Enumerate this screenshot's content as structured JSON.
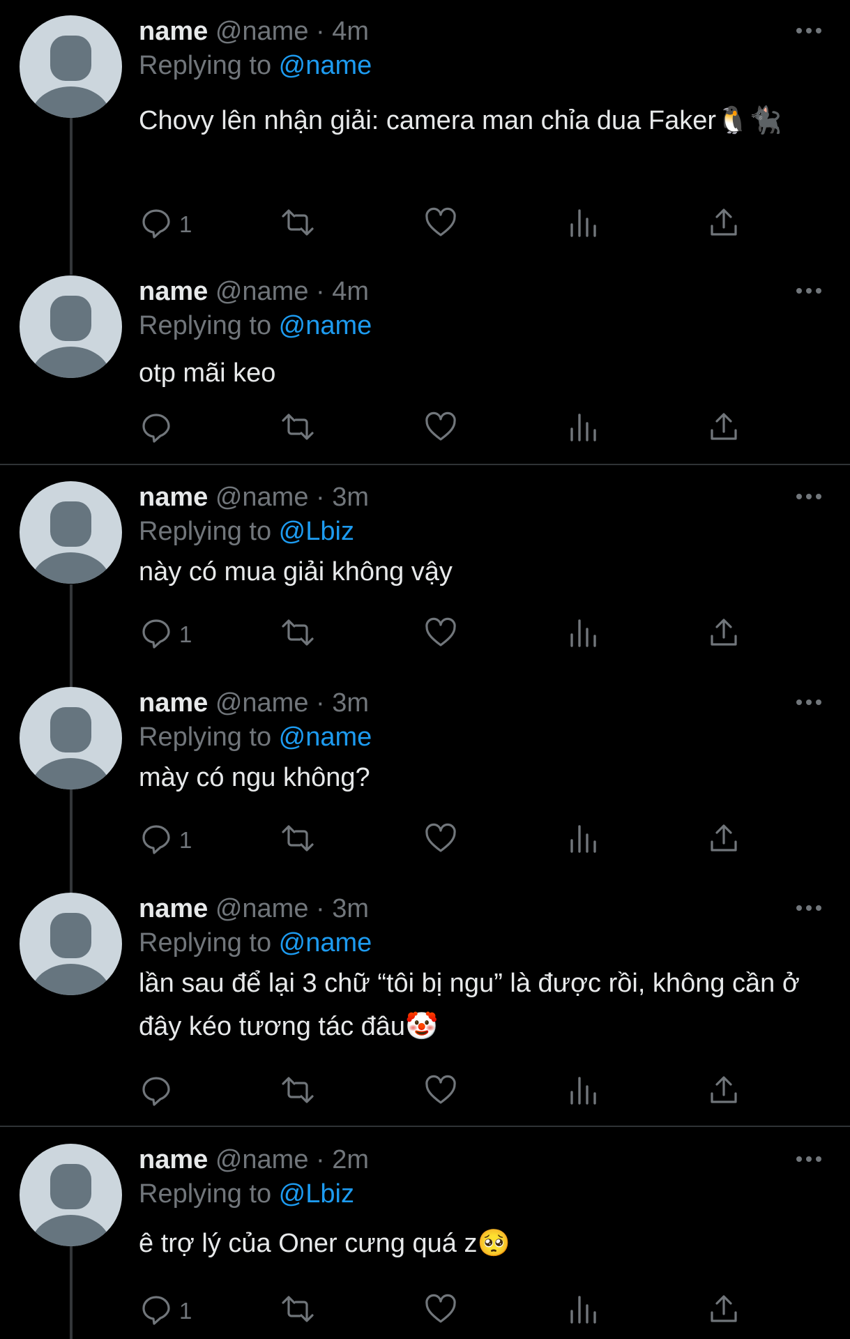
{
  "tweets": [
    {
      "name": "name",
      "meta": "@name · 4m",
      "replying_prefix": "Replying to ",
      "replying_handle": "@name",
      "text": "Chovy lên nhận giải: camera man chỉa dua Faker",
      "emoji": "🐧🐈‍⬛",
      "reply_count": "1"
    },
    {
      "name": "name",
      "meta": "@name · 4m",
      "replying_prefix": "Replying to ",
      "replying_handle": "@name",
      "text": "otp mãi keo",
      "reply_count": ""
    },
    {
      "name": "name",
      "meta": "@name · 3m",
      "replying_prefix": "Replying to ",
      "replying_handle": "@Lbiz",
      "text": "này có mua giải không vậy",
      "reply_count": "1"
    },
    {
      "name": "name",
      "meta": "@name · 3m",
      "replying_prefix": "Replying to ",
      "replying_handle": "@name",
      "text": "mày có ngu không?",
      "reply_count": "1"
    },
    {
      "name": "name",
      "meta": "@name · 3m",
      "replying_prefix": "Replying to ",
      "replying_handle": "@name",
      "text": "lần sau để lại 3 chữ “tôi bị ngu” là được rồi, không cần ở đây kéo tương tác đâu",
      "emoji": "🤡",
      "reply_count": ""
    },
    {
      "name": "name",
      "meta": "@name · 2m",
      "replying_prefix": "Replying to ",
      "replying_handle": "@Lbiz",
      "text": "ê trợ lý của Oner cưng quá z",
      "emoji": "🥺",
      "reply_count": "1"
    }
  ],
  "icons": {
    "reply": "reply-icon",
    "retweet": "retweet-icon",
    "like": "heart-icon",
    "views": "views-icon",
    "share": "share-icon",
    "more": "more-icon"
  },
  "colors": {
    "background": "#000000",
    "text": "#e7e9ea",
    "muted": "#71767b",
    "link": "#1d9bf0",
    "avatar_bg": "#ccd6dd",
    "avatar_fg": "#66757f"
  }
}
